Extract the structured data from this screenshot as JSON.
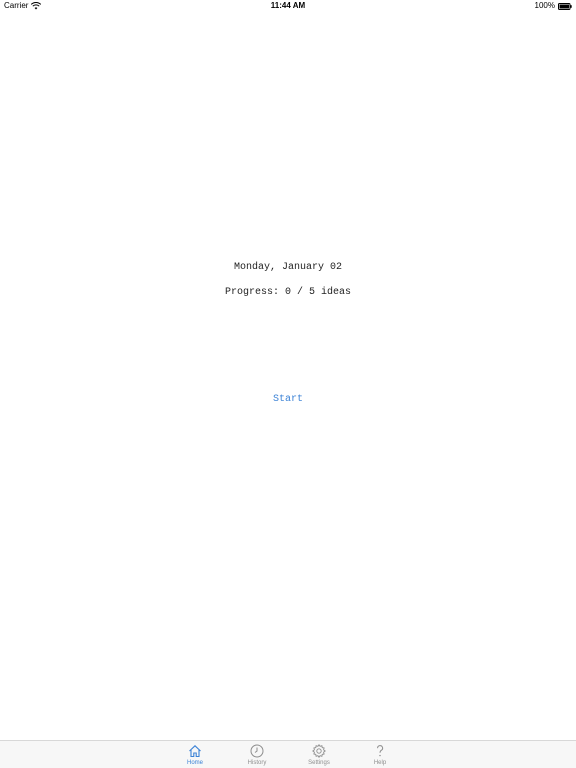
{
  "status_bar": {
    "carrier": "Carrier",
    "time": "11:44 AM",
    "battery": "100%",
    "icons": [
      "wifi-icon",
      "battery-icon"
    ]
  },
  "main": {
    "date": "Monday, January 02",
    "progress": "Progress: 0 / 5 ideas",
    "start_label": "Start"
  },
  "tab_bar": {
    "items": [
      {
        "label": "Home",
        "icon": "home-icon",
        "active": true
      },
      {
        "label": "History",
        "icon": "clock-icon",
        "active": false
      },
      {
        "label": "Settings",
        "icon": "gear-icon",
        "active": false
      },
      {
        "label": "Help",
        "icon": "question-icon",
        "active": false
      }
    ]
  },
  "colors": {
    "accent": "#3b82d6",
    "inactive": "#8e8e8e",
    "tab_background": "#f7f7f7"
  }
}
